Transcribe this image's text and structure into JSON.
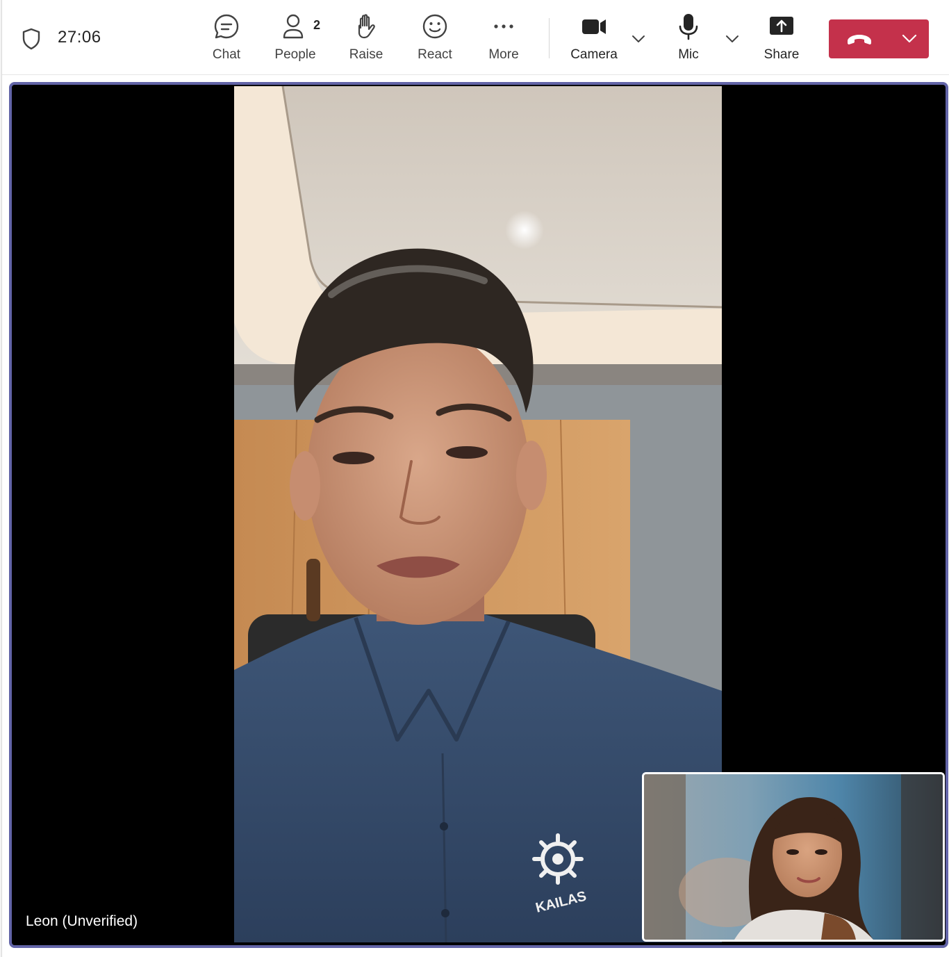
{
  "meeting": {
    "timer": "27:06"
  },
  "toolbar": {
    "chat_label": "Chat",
    "people_label": "People",
    "people_count": "2",
    "raise_label": "Raise",
    "react_label": "React",
    "more_label": "More",
    "camera_label": "Camera",
    "mic_label": "Mic",
    "share_label": "Share"
  },
  "stage": {
    "main_participant": "Leon (Unverified)",
    "shirt_logo_text": "KAILAS"
  },
  "colors": {
    "accent": "#6264a7",
    "leave": "#c4314b"
  }
}
